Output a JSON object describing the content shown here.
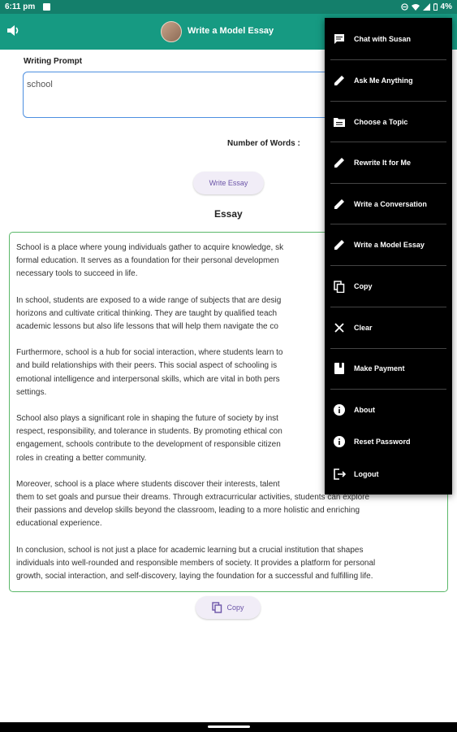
{
  "status_bar": {
    "time": "6:11 pm",
    "battery": "4%"
  },
  "app_bar": {
    "title": "Write a Model Essay"
  },
  "prompt": {
    "label": "Writing Prompt",
    "value": "school"
  },
  "words_label": "Number of Words :",
  "write_button": "Write Essay",
  "essay": {
    "heading": "Essay",
    "paragraphs": [
      "School is a place where young individuals gather to acquire knowledge, sk",
      "formal education. It serves as a foundation for their personal developmen",
      "necessary tools to succeed in life.",
      "In school, students are exposed to a wide range of subjects that are desig",
      "horizons and cultivate critical thinking. They are taught by qualified teach",
      "academic lessons but also life lessons that will help them navigate the co",
      "Furthermore, school is a hub for social interaction, where students learn to",
      "and build relationships with their peers. This social aspect of schooling is",
      "emotional intelligence and interpersonal skills, which are vital in both pers",
      "settings.",
      "School also plays a significant role in shaping the future of society by inst",
      "respect, responsibility, and tolerance in students. By promoting ethical con",
      "engagement, schools contribute to the development of responsible citizen",
      "roles in creating a better community.",
      "Moreover, school is a place where students discover their interests, talent",
      "them to set goals and pursue their dreams. Through extracurricular activities, students can explore",
      "their passions and develop skills beyond the classroom, leading to a more holistic and enriching",
      "educational experience.",
      "In conclusion, school is not just a place for academic learning but a crucial institution that shapes",
      "individuals into well-rounded and responsible members of society. It provides a platform for personal",
      "growth, social interaction, and self-discovery, laying the foundation for a successful and fulfilling life."
    ]
  },
  "copy_button": "Copy",
  "menu": {
    "items": [
      {
        "label": "Chat with Susan",
        "icon": "chat-icon"
      },
      {
        "label": "Ask Me Anything",
        "icon": "pencil-icon"
      },
      {
        "label": "Choose a Topic",
        "icon": "topic-icon"
      },
      {
        "label": "Rewrite It for Me",
        "icon": "pencil-icon"
      },
      {
        "label": "Write a Conversation",
        "icon": "pencil-icon"
      },
      {
        "label": "Write a Model Essay",
        "icon": "pencil-icon"
      },
      {
        "label": "Copy",
        "icon": "copy-icon"
      },
      {
        "label": "Clear",
        "icon": "close-icon"
      },
      {
        "label": "Make Payment",
        "icon": "book-icon"
      },
      {
        "label": "About",
        "icon": "info-icon"
      },
      {
        "label": "Reset Password",
        "icon": "info-icon"
      },
      {
        "label": "Logout",
        "icon": "logout-icon"
      }
    ]
  }
}
